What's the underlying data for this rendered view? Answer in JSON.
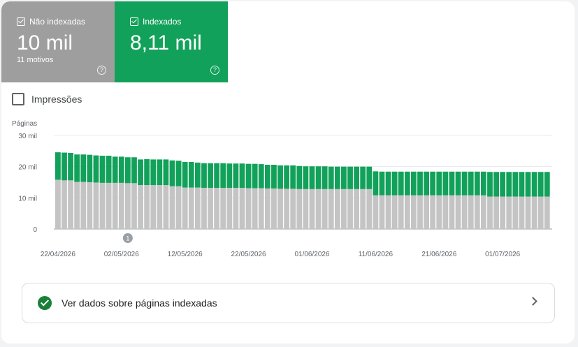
{
  "tiles": {
    "not_indexed": {
      "label": "Não indexadas",
      "value": "10 mil",
      "sub": "11 motivos",
      "color": "#9e9e9e"
    },
    "indexed": {
      "label": "Indexados",
      "value": "8,11 mil",
      "color": "#12a15a"
    }
  },
  "impressions_label": "Impressões",
  "link_label": "Ver dados sobre páginas indexadas",
  "chart_data": {
    "type": "bar",
    "stacked": true,
    "ylabel": "Páginas",
    "ylim": [
      0,
      30000
    ],
    "y_ticks": [
      {
        "value": 0,
        "label": "0"
      },
      {
        "value": 10000,
        "label": "10 mil"
      },
      {
        "value": 20000,
        "label": "20 mil"
      },
      {
        "value": 30000,
        "label": "30 mil"
      }
    ],
    "x_ticks": [
      "22/04/2026",
      "02/05/2026",
      "12/05/2026",
      "22/05/2026",
      "01/06/2026",
      "11/06/2026",
      "21/06/2026",
      "01/07/2026"
    ],
    "annotation": {
      "label": "1",
      "date_index": 11
    },
    "grid": true,
    "series": [
      {
        "name": "Não indexadas",
        "color": "#c4c4c4",
        "values": [
          15800,
          15600,
          15600,
          15100,
          15100,
          15000,
          14900,
          14800,
          14800,
          14800,
          14800,
          14700,
          14700,
          14100,
          14100,
          14100,
          14100,
          14100,
          13700,
          13700,
          13300,
          13300,
          13300,
          13200,
          13200,
          13200,
          13200,
          13200,
          13200,
          13200,
          13100,
          13100,
          13100,
          13000,
          13000,
          12900,
          12900,
          12900,
          12800,
          12800,
          12800,
          12800,
          12800,
          12800,
          12800,
          12800,
          12800,
          12800,
          12800,
          12800,
          10800,
          10800,
          10800,
          10800,
          10800,
          10800,
          10800,
          10800,
          10800,
          10800,
          10800,
          10800,
          10800,
          10800,
          10800,
          10800,
          10800,
          10800,
          10400,
          10400,
          10400,
          10400,
          10400,
          10400,
          10400,
          10400,
          10400,
          10400
        ]
      },
      {
        "name": "Indexados",
        "color": "#12a15a",
        "values": [
          8800,
          8900,
          8800,
          8800,
          8800,
          8800,
          8700,
          8700,
          8700,
          8400,
          8400,
          8300,
          8300,
          8200,
          8300,
          8200,
          8200,
          8200,
          8300,
          8200,
          8200,
          8200,
          8000,
          7900,
          7900,
          7900,
          7900,
          7800,
          7800,
          7800,
          7800,
          7800,
          7700,
          7600,
          7600,
          7500,
          7500,
          7500,
          7400,
          7300,
          7300,
          7300,
          7300,
          7200,
          7200,
          7200,
          7200,
          7200,
          7200,
          7200,
          7700,
          7600,
          7600,
          7600,
          7600,
          7600,
          7600,
          7600,
          7600,
          7600,
          7600,
          7600,
          7600,
          7600,
          7600,
          7600,
          7600,
          7600,
          7900,
          7900,
          7900,
          7900,
          7900,
          7900,
          7900,
          7900,
          7900,
          7900
        ]
      }
    ]
  }
}
